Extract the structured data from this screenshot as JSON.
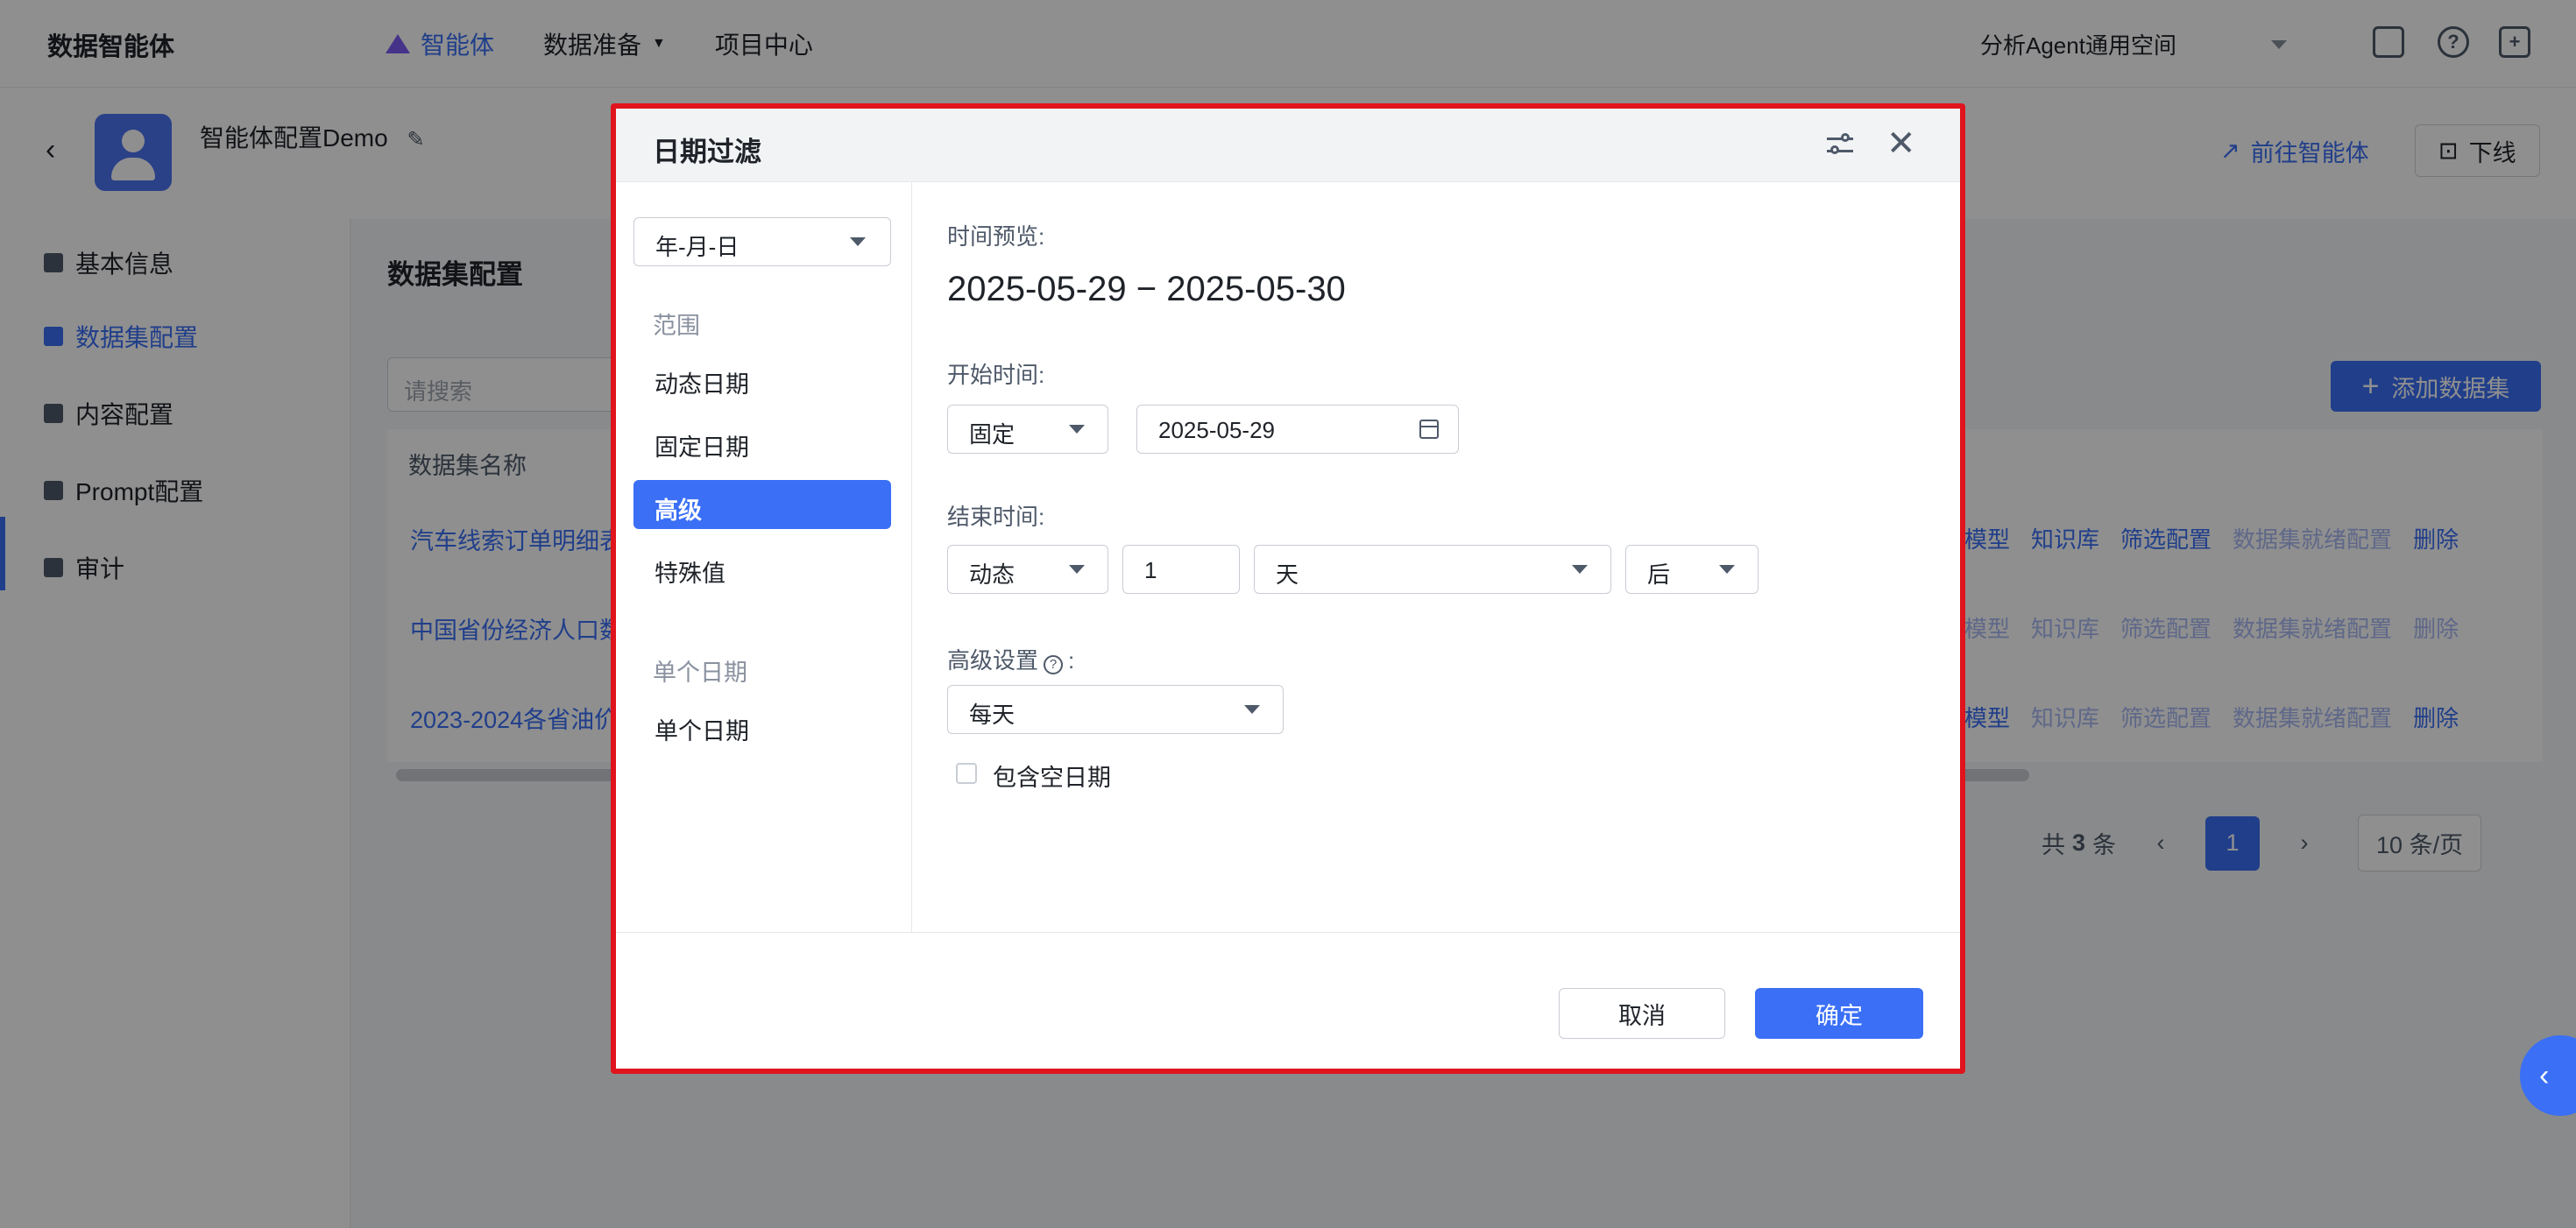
{
  "topbar": {
    "brand": "数据智能体",
    "nav": [
      {
        "label": "智能体",
        "active": true
      },
      {
        "label": "数据准备",
        "has_dropdown": true
      },
      {
        "label": "项目中心"
      }
    ],
    "workspace": "分析Agent通用空间",
    "icons": [
      "monitor-icon",
      "help-icon",
      "fullscreen-icon"
    ]
  },
  "agent": {
    "name": "智能体配置Demo",
    "goto_label": "前往智能体",
    "offline_label": "下线"
  },
  "sidebar": {
    "items": [
      {
        "label": "基本信息"
      },
      {
        "label": "数据集配置",
        "active": true
      },
      {
        "label": "内容配置"
      },
      {
        "label": "Prompt配置"
      },
      {
        "label": "审计"
      }
    ]
  },
  "main": {
    "section_title": "数据集配置",
    "search_placeholder": "请搜索",
    "add_button": "添加数据集",
    "table": {
      "header": "数据集名称",
      "rows": [
        {
          "name": "汽车线索订单明细表"
        },
        {
          "name": "中国省份经济人口数据"
        },
        {
          "name": "2023-2024各省油价"
        }
      ],
      "actions": [
        "模型",
        "知识库",
        "筛选配置",
        "数据集就绪配置",
        "删除"
      ]
    },
    "pagination": {
      "total_prefix": "共",
      "total": "3",
      "total_suffix": "条",
      "current_page": "1",
      "page_size": "10 条/页"
    }
  },
  "dialog": {
    "title": "日期过滤",
    "granularity": "年-月-日",
    "range_group": "范围",
    "range_items": [
      {
        "label": "动态日期"
      },
      {
        "label": "固定日期"
      },
      {
        "label": "高级",
        "active": true
      },
      {
        "label": "特殊值"
      }
    ],
    "single_group": "单个日期",
    "single_items": [
      {
        "label": "单个日期"
      }
    ],
    "preview_label": "时间预览:",
    "preview_value": "2025-05-29 − 2025-05-30",
    "start_label": "开始时间:",
    "start_mode": "固定",
    "start_date": "2025-05-29",
    "end_label": "结束时间:",
    "end_mode": "动态",
    "end_offset": "1",
    "end_unit": "天",
    "end_direction": "后",
    "advanced_label": "高级设置",
    "advanced_label_suffix": ":",
    "frequency": "每天",
    "include_empty_label": "包含空日期",
    "include_empty_checked": false,
    "cancel": "取消",
    "confirm": "确定"
  },
  "colors": {
    "primary": "#3a6ff6",
    "highlight_border": "#e0141c"
  }
}
